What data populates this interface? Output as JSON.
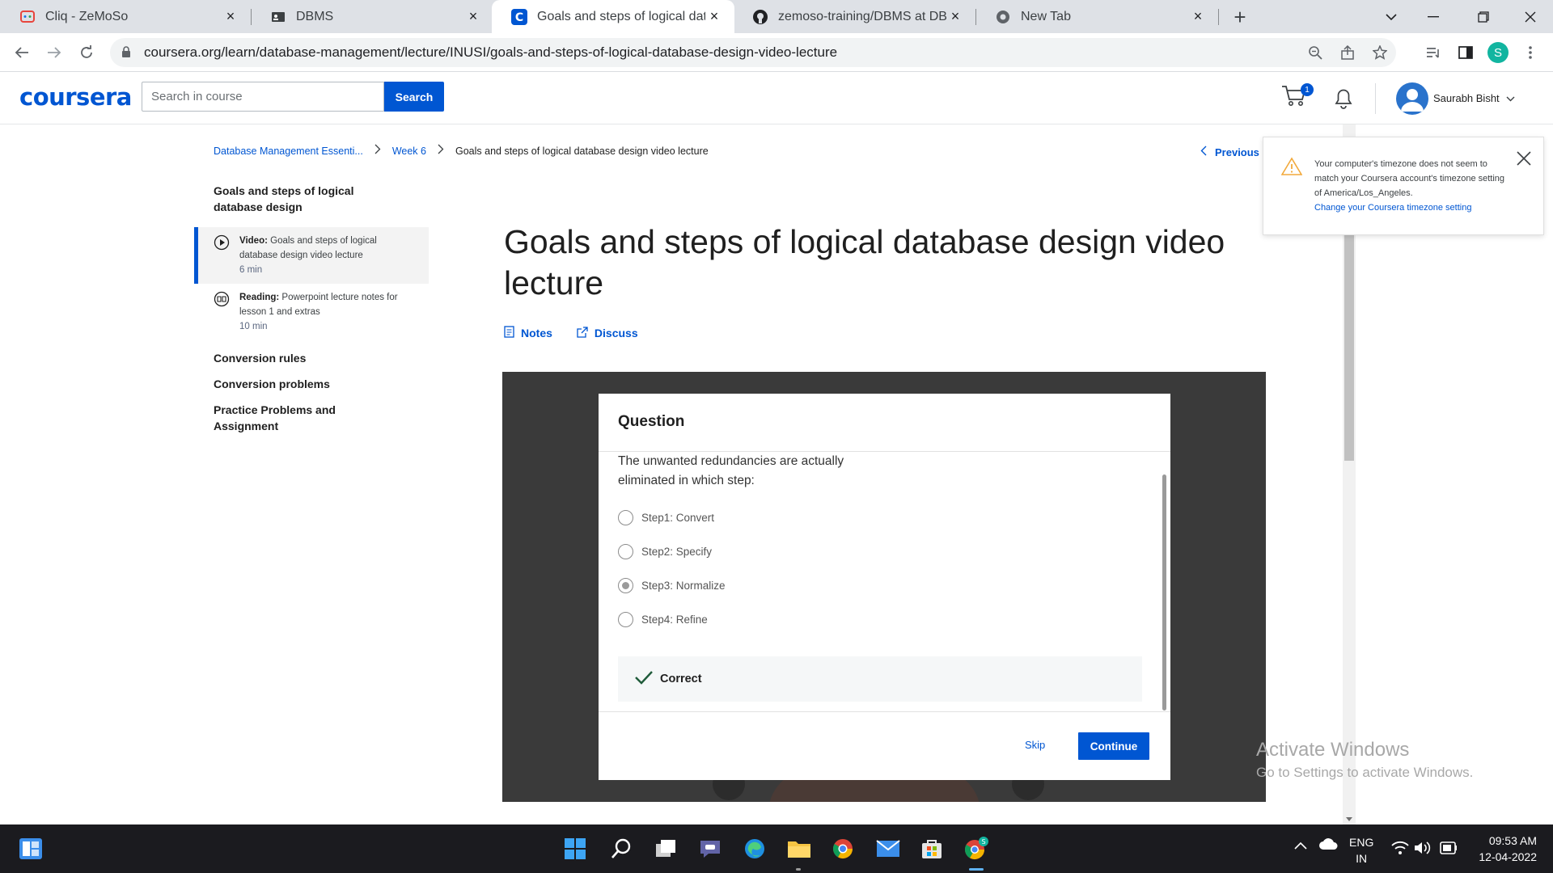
{
  "browser": {
    "tabs": [
      {
        "title": "Cliq - ZeMoSo",
        "close": "×",
        "active": false
      },
      {
        "title": "DBMS",
        "close": "×",
        "active": false
      },
      {
        "title": "Goals and steps of logical database design video lecture",
        "close": "×",
        "active": true
      },
      {
        "title": "zemoso-training/DBMS at DBMS",
        "close": "×",
        "active": false
      },
      {
        "title": "New Tab",
        "close": "×",
        "active": false
      }
    ],
    "new_tab": "+",
    "url": "coursera.org/learn/database-management/lecture/INUSI/goals-and-steps-of-logical-database-design-video-lecture",
    "profile_initial": "S"
  },
  "header": {
    "logo": "coursera",
    "search_placeholder": "Search in course",
    "search_button": "Search",
    "cart_count": "1",
    "user_name": "Saurabh Bisht"
  },
  "breadcrumb": {
    "course": "Database Management Essenti...",
    "week": "Week 6",
    "current": "Goals and steps of logical database design video lecture"
  },
  "previous_label": "Previous",
  "sidenav": {
    "lesson_heading": "Goals and steps of logical database design",
    "items": [
      {
        "type": "Video:",
        "title": "Goals and steps of logical database design video lecture",
        "duration": "6 min"
      },
      {
        "type": "Reading:",
        "title": "Powerpoint lecture notes for lesson 1 and extras",
        "duration": "10 min"
      }
    ],
    "modules": [
      "Conversion rules",
      "Conversion problems",
      "Practice Problems and Assignment"
    ]
  },
  "lecture": {
    "title": "Goals and steps of logical database design video lecture",
    "notes_label": "Notes",
    "discuss_label": "Discuss"
  },
  "quiz": {
    "heading": "Question",
    "question": "The unwanted redundancies are actually eliminated in which step:",
    "options": [
      "Step1: Convert",
      "Step2: Specify",
      "Step3: Normalize",
      "Step4: Refine"
    ],
    "selected_index": 2,
    "feedback": "Correct",
    "skip_label": "Skip",
    "continue_label": "Continue"
  },
  "toast": {
    "message": "Your computer's timezone does not seem to match your Coursera account's timezone setting of America/Los_Angeles.",
    "link": "Change your Coursera timezone setting"
  },
  "watermark": {
    "line1": "Activate Windows",
    "line2": "Go to Settings to activate Windows."
  },
  "taskbar": {
    "lang1": "ENG",
    "lang2": "IN",
    "time": "09:53 AM",
    "date": "12-04-2022"
  },
  "colors": {
    "brand_blue": "#0056d2",
    "tabstrip": "#dee1e6",
    "taskbar": "#1b1b1f",
    "video_bg": "#3a3a3a"
  }
}
